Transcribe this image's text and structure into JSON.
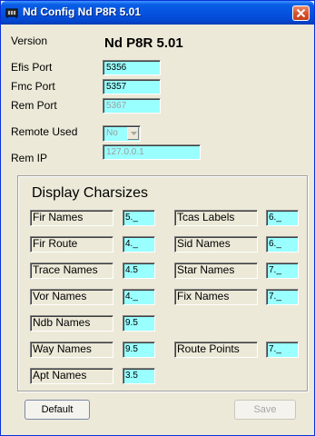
{
  "window": {
    "title": "Nd Config Nd P8R 5.01",
    "colors": {
      "titlebar": "#0553e0",
      "field_bg": "#99ffff",
      "close_button": "#d9532e"
    }
  },
  "general": {
    "version_label": "Version",
    "version_value": "Nd P8R  5.01",
    "efis_port_label": "Efis Port",
    "efis_port_value": "5356",
    "fmc_port_label": "Fmc Port",
    "fmc_port_value": "5357",
    "rem_port_label": "Rem Port",
    "rem_port_value": "5367",
    "remote_used_label": "Remote Used",
    "remote_used_value": "No",
    "rem_ip_label": "Rem IP",
    "rem_ip_value": "127.0.0.1"
  },
  "charsizes": {
    "title": "Display Charsizes",
    "left": [
      {
        "label": "Fir Names",
        "value": "5._"
      },
      {
        "label": "Fir Route",
        "value": "4._"
      },
      {
        "label": "Trace Names",
        "value": "4.5"
      },
      {
        "label": "Vor Names",
        "value": "4._"
      },
      {
        "label": "Ndb Names",
        "value": "9.5"
      },
      {
        "label": "Way Names",
        "value": "9.5"
      },
      {
        "label": "Apt Names",
        "value": "3.5"
      }
    ],
    "right": [
      {
        "label": "Tcas Labels",
        "value": "6._"
      },
      {
        "label": "Sid Names",
        "value": "6._"
      },
      {
        "label": "Star Names",
        "value": "7._"
      },
      {
        "label": "Fix Names",
        "value": "7._"
      },
      {
        "label": "Route Points",
        "value": "7._"
      }
    ]
  },
  "buttons": {
    "default_label": "Default",
    "save_label": "Save"
  }
}
